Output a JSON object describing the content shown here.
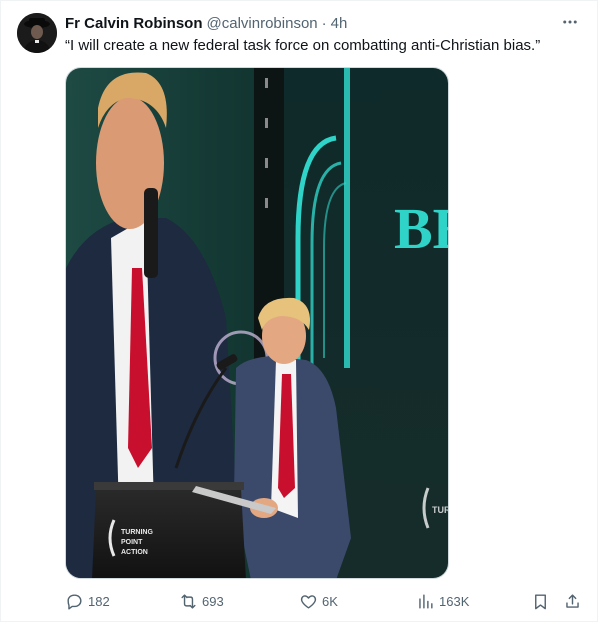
{
  "tweet": {
    "author_name": "Fr Calvin Robinson",
    "handle": "@calvinrobinson",
    "separator": "·",
    "time": "4h",
    "text": "“I will create a new federal task force on combatting anti-Christian bias.”"
  },
  "media": {
    "sign_text": "BEL",
    "podium_text_1": "TURNING",
    "podium_text_2": "POINT",
    "podium_text_3": "ACTION",
    "screen_logo_text": "TURN"
  },
  "actions": {
    "replies": "182",
    "reposts": "693",
    "likes": "6K",
    "views": "163K"
  },
  "colors": {
    "text_primary": "#0f1419",
    "text_secondary": "#536471",
    "tie_red": "#c8102e",
    "neon_teal": "#2fd3c8"
  }
}
